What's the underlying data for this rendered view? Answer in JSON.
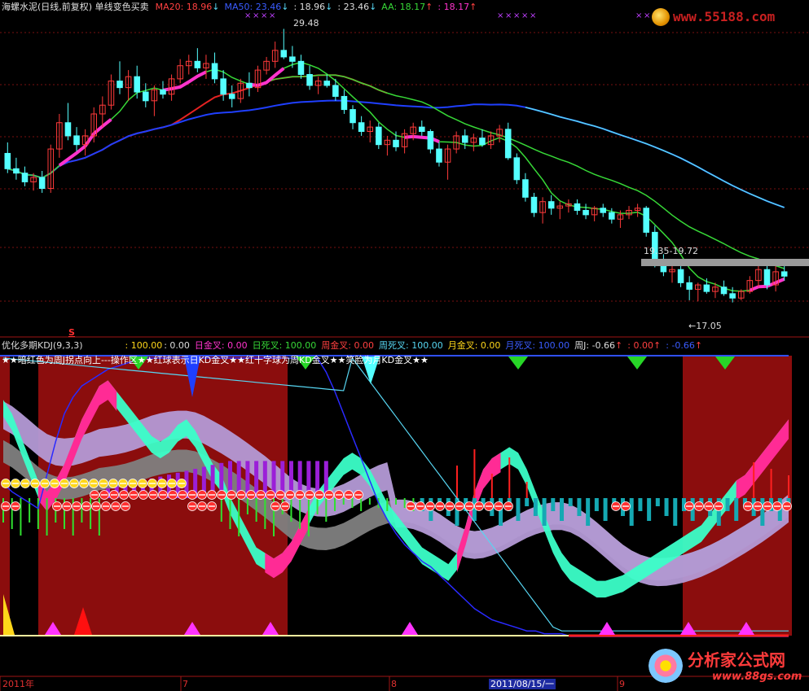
{
  "colors": {
    "bg": "#000000",
    "ma20": "#e52222",
    "ma50": "#1f3fff",
    "ma_green": "#37d837",
    "cyan": "#57d6f2",
    "magenta": "#ff33cc",
    "up_candle": "#ff3a3a",
    "down_candle": "#54ffff",
    "darkred_zone": "#8b0d0d",
    "gray_band": "#808080",
    "lavender_band": "#b49ad6",
    "mint_band": "#3bffc8",
    "pink_band": "#ff2b95",
    "purple_bar": "#9b1fd8",
    "green_bar": "#30e030",
    "teal_bar": "#15a9b3",
    "red_bar": "#ff2020",
    "yellow": "#ffd71a"
  },
  "top_header": {
    "title": "海螺水泥(日线,前复权) 单线变色买卖",
    "ma20_label": "MA20: 18.96",
    "ma20_arrow": "↓",
    "ma50_label": "MA50: 23.46",
    "ma50_arrow": "↓",
    "v1": ": 18.96",
    "v1_arrow": "↓",
    "v2": ": 23.46",
    "v2_arrow": "↓",
    "aa_label": "AA: 18.17",
    "aa_arrow": "↑",
    "v3": ": 18.17",
    "v3_arrow": "↑"
  },
  "top_annotations": {
    "high": "29.48",
    "range": "19.35-19.72",
    "low": "←17.05",
    "marker": "S"
  },
  "bottom_header": {
    "title": "优化多期KDJ(9,3,3)",
    "v1": ": 100.00",
    "v2": ": 0.00",
    "daily_golden": "日金叉: 0.00",
    "daily_dead": "日死叉: 100.00",
    "weekly_golden": "周金叉: 0.00",
    "weekly_dead": "周死叉: 100.00",
    "monthly_golden": "月金叉: 0.00",
    "monthly_dead": "月死叉: 100.00",
    "weekly_j": "周J: -0.66",
    "weekly_j_arrow": "↑",
    "v3": ": 0.00",
    "v3_arrow": "↑",
    "v4": ": -0.66",
    "v4_arrow": "↑"
  },
  "bottom_note": "★★暗红色为周J拐点向上---操作区★★红球表示日KD金叉★★红十字球为周KD金叉★★笑脸为月KD金叉★★",
  "x_axis": {
    "labels": [
      "2011年",
      "7",
      "8",
      "2011/08/15/一",
      "9"
    ]
  },
  "watermark_top": "www.55188.com",
  "watermark_bottom": "分析家公式网",
  "watermark_bottom_url": "www.88gs.com",
  "chart_data": [
    {
      "type": "candlestick",
      "title": "海螺水泥(日线,前复权) 单线变色买卖",
      "price_range": [
        15.5,
        30.5
      ],
      "candles": [
        [
          23.8,
          24.3,
          22.9,
          23.1
        ],
        [
          23.1,
          23.6,
          22.6,
          22.9
        ],
        [
          22.9,
          23.2,
          22.3,
          22.5
        ],
        [
          22.5,
          22.9,
          22.1,
          22.7
        ],
        [
          22.7,
          23.0,
          22.0,
          22.2
        ],
        [
          22.2,
          24.2,
          22.0,
          24.0
        ],
        [
          24.0,
          25.6,
          23.6,
          25.2
        ],
        [
          25.2,
          26.1,
          24.4,
          24.6
        ],
        [
          24.6,
          25.0,
          23.9,
          24.2
        ],
        [
          24.2,
          24.9,
          23.7,
          24.6
        ],
        [
          24.6,
          25.9,
          24.3,
          25.6
        ],
        [
          25.6,
          26.4,
          25.0,
          26.0
        ],
        [
          26.0,
          27.4,
          25.8,
          27.1
        ],
        [
          27.1,
          28.0,
          26.5,
          26.8
        ],
        [
          26.8,
          27.6,
          26.2,
          27.3
        ],
        [
          27.3,
          27.8,
          26.3,
          26.6
        ],
        [
          26.6,
          27.0,
          25.9,
          26.2
        ],
        [
          26.2,
          26.9,
          25.5,
          26.7
        ],
        [
          26.7,
          27.1,
          26.3,
          26.5
        ],
        [
          26.5,
          27.4,
          26.2,
          27.2
        ],
        [
          27.2,
          28.1,
          27.0,
          27.8
        ],
        [
          27.8,
          28.3,
          27.4,
          28.0
        ],
        [
          28.0,
          28.6,
          27.5,
          27.7
        ],
        [
          27.7,
          28.3,
          27.2,
          27.9
        ],
        [
          27.9,
          28.4,
          27.0,
          27.2
        ],
        [
          27.2,
          27.6,
          26.2,
          26.5
        ],
        [
          26.5,
          26.9,
          25.9,
          26.3
        ],
        [
          26.3,
          27.2,
          26.1,
          27.0
        ],
        [
          27.0,
          27.5,
          26.4,
          26.8
        ],
        [
          26.8,
          27.8,
          26.6,
          27.6
        ],
        [
          27.6,
          28.2,
          27.4,
          28.0
        ],
        [
          28.0,
          28.9,
          27.7,
          28.5
        ],
        [
          28.5,
          29.48,
          28.1,
          28.2
        ],
        [
          28.2,
          28.7,
          27.7,
          28.0
        ],
        [
          28.0,
          28.3,
          27.2,
          27.4
        ],
        [
          27.4,
          27.8,
          26.7,
          26.9
        ],
        [
          26.9,
          27.3,
          26.5,
          27.1
        ],
        [
          27.1,
          27.4,
          26.8,
          26.9
        ],
        [
          26.9,
          27.2,
          26.2,
          26.4
        ],
        [
          26.4,
          26.7,
          25.6,
          25.8
        ],
        [
          25.8,
          26.0,
          24.9,
          25.2
        ],
        [
          25.2,
          25.5,
          24.6,
          24.8
        ],
        [
          24.8,
          25.3,
          24.3,
          25.0
        ],
        [
          25.0,
          25.2,
          24.0,
          24.2
        ],
        [
          24.2,
          24.6,
          23.7,
          24.4
        ],
        [
          24.4,
          24.8,
          23.9,
          24.1
        ],
        [
          24.1,
          24.9,
          23.8,
          24.7
        ],
        [
          24.7,
          25.2,
          24.4,
          25.0
        ],
        [
          25.0,
          25.3,
          24.6,
          24.8
        ],
        [
          24.8,
          24.9,
          23.8,
          24.0
        ],
        [
          24.0,
          24.3,
          23.2,
          23.4
        ],
        [
          23.4,
          24.2,
          22.6,
          24.0
        ],
        [
          24.0,
          24.8,
          23.8,
          24.6
        ],
        [
          24.6,
          24.9,
          24.0,
          24.3
        ],
        [
          24.3,
          24.7,
          23.9,
          24.5
        ],
        [
          24.5,
          24.9,
          24.1,
          24.2
        ],
        [
          24.2,
          24.8,
          24.0,
          24.6
        ],
        [
          24.6,
          25.1,
          24.3,
          24.9
        ],
        [
          24.9,
          25.2,
          23.5,
          23.6
        ],
        [
          23.6,
          23.8,
          22.4,
          22.6
        ],
        [
          22.6,
          22.9,
          21.6,
          21.8
        ],
        [
          21.8,
          22.0,
          20.9,
          21.1
        ],
        [
          21.1,
          21.8,
          20.6,
          21.6
        ],
        [
          21.6,
          21.9,
          21.0,
          21.3
        ],
        [
          21.3,
          21.6,
          20.8,
          21.4
        ],
        [
          21.4,
          21.7,
          21.1,
          21.5
        ],
        [
          21.5,
          21.7,
          21.0,
          21.2
        ],
        [
          21.2,
          21.5,
          20.8,
          21.0
        ],
        [
          21.0,
          21.4,
          20.7,
          21.3
        ],
        [
          21.3,
          21.5,
          20.9,
          21.1
        ],
        [
          21.1,
          21.3,
          20.6,
          20.8
        ],
        [
          20.8,
          21.2,
          20.4,
          21.0
        ],
        [
          21.0,
          21.4,
          20.8,
          21.2
        ],
        [
          21.2,
          21.5,
          20.9,
          21.3
        ],
        [
          21.3,
          21.4,
          20.0,
          20.2
        ],
        [
          20.2,
          20.5,
          18.6,
          18.8
        ],
        [
          18.8,
          19.2,
          18.2,
          18.4
        ],
        [
          18.4,
          18.7,
          17.9,
          18.5
        ],
        [
          18.5,
          18.8,
          17.7,
          17.9
        ],
        [
          17.9,
          18.2,
          17.1,
          17.6
        ],
        [
          17.6,
          17.9,
          17.05,
          17.8
        ],
        [
          17.8,
          18.1,
          17.4,
          17.5
        ],
        [
          17.5,
          17.9,
          17.2,
          17.7
        ],
        [
          17.7,
          18.0,
          17.3,
          17.4
        ],
        [
          17.4,
          17.7,
          17.0,
          17.2
        ],
        [
          17.2,
          17.6,
          17.1,
          17.5
        ],
        [
          17.5,
          18.2,
          17.4,
          18.0
        ],
        [
          18.0,
          18.9,
          17.7,
          18.5
        ],
        [
          18.5,
          18.8,
          17.6,
          17.8
        ],
        [
          17.8,
          18.7,
          17.5,
          18.4
        ],
        [
          18.4,
          18.9,
          18.0,
          18.2
        ]
      ]
    },
    {
      "type": "line",
      "title": "优化多期KDJ(9,3,3)",
      "y_range": [
        0,
        100
      ],
      "series": [
        {
          "name": "日金叉",
          "values": [
            55,
            52,
            50,
            48,
            46,
            58,
            70,
            80,
            86,
            90,
            92,
            94,
            96,
            97,
            98,
            99,
            100,
            100,
            100,
            100,
            100,
            100,
            100,
            100,
            100,
            100,
            100,
            100,
            100,
            100,
            100,
            100,
            100,
            100,
            100,
            100,
            100,
            95,
            88,
            80,
            72,
            64,
            56,
            48,
            42,
            37,
            33,
            30,
            27,
            25,
            22,
            19,
            16,
            13,
            10,
            8,
            6,
            5,
            4,
            3,
            2,
            2,
            1,
            1,
            1,
            0,
            0,
            0,
            0,
            0,
            0,
            0,
            0,
            0,
            0,
            0,
            0,
            0,
            0,
            0,
            0,
            0,
            0,
            0,
            0,
            0,
            0,
            0,
            0,
            0,
            0
          ]
        },
        {
          "name": "周死叉",
          "values": [
            85,
            80,
            72,
            64,
            56,
            52,
            56,
            62,
            70,
            78,
            84,
            90,
            92,
            88,
            84,
            80,
            76,
            72,
            70,
            72,
            76,
            78,
            74,
            68,
            62,
            58,
            50,
            44,
            38,
            32,
            30,
            28,
            30,
            34,
            40,
            46,
            52,
            56,
            60,
            64,
            66,
            64,
            60,
            54,
            48,
            44,
            40,
            36,
            32,
            30,
            28,
            26,
            30,
            40,
            52,
            60,
            64,
            66,
            68,
            66,
            60,
            52,
            44,
            36,
            30,
            26,
            24,
            22,
            20,
            20,
            21,
            22,
            24,
            26,
            28,
            30,
            32,
            34,
            36,
            38,
            40,
            44,
            48,
            52,
            56,
            58,
            62,
            66,
            70,
            74,
            78
          ]
        }
      ]
    }
  ]
}
